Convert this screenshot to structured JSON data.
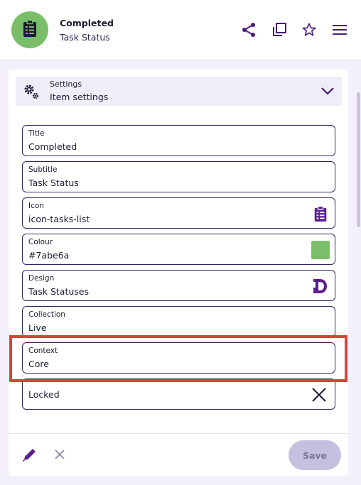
{
  "header": {
    "title": "Completed",
    "subtitle": "Task Status",
    "avatar_color": "#7abe6a",
    "avatar_icon": "clipboard-list-icon",
    "actions": [
      "share-icon",
      "copy-icon",
      "star-icon",
      "menu-icon"
    ]
  },
  "section": {
    "small_label": "Settings",
    "label": "Item settings",
    "icon": "gears-icon",
    "toggle_icon": "chevron-down-icon"
  },
  "fields": {
    "title": {
      "label": "Title",
      "value": "Completed"
    },
    "subtitle": {
      "label": "Subtitle",
      "value": "Task Status"
    },
    "icon": {
      "label": "Icon",
      "value": "icon-tasks-list",
      "icon": "clipboard-list-icon"
    },
    "colour": {
      "label": "Colour",
      "value": "#7abe6a",
      "swatch": "#7abe6a"
    },
    "design": {
      "label": "Design",
      "value": "Task Statuses",
      "icon": "design-logo-icon"
    },
    "collection": {
      "label": "Collection",
      "value": "Live"
    },
    "context": {
      "label": "Context",
      "value": "Core"
    },
    "locked": {
      "label": "Locked",
      "icon": "close-icon"
    }
  },
  "footer": {
    "save_label": "Save"
  },
  "colors": {
    "accent": "#5b1f8f",
    "highlight": "#d9433a",
    "save_bg": "#c5bfe0"
  }
}
